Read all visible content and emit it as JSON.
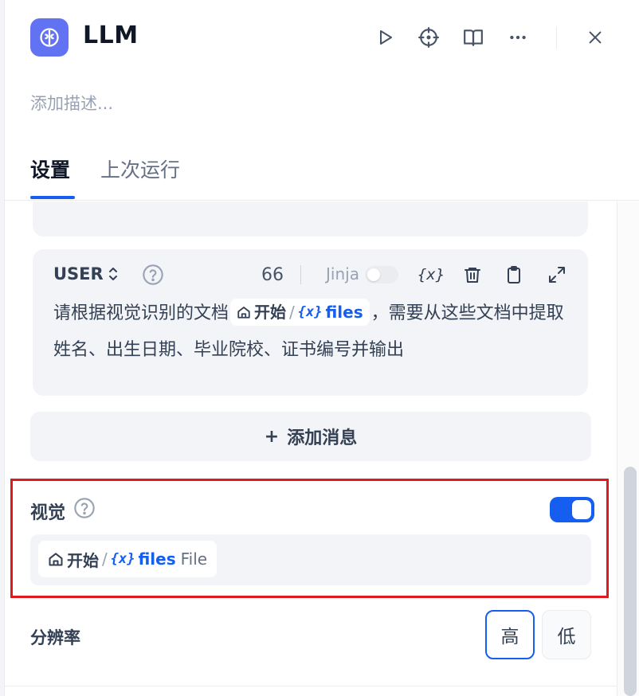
{
  "header": {
    "title": "LLM",
    "description_placeholder": "添加描述..."
  },
  "tabs": [
    {
      "label": "设置",
      "active": true
    },
    {
      "label": "上次运行",
      "active": false
    }
  ],
  "user_message": {
    "role": "USER",
    "token_count": "66",
    "jinja_label": "Jinja",
    "jinja_enabled": false,
    "prompt_before": "请根据视觉识别的文档",
    "var_node": "开始",
    "var_name": "files",
    "prompt_after": "，需要从这些文档中提取姓名、出生日期、毕业院校、证书编号并输出"
  },
  "add_message": {
    "plus": "+",
    "label": "添加消息"
  },
  "vision": {
    "label": "视觉",
    "enabled": true,
    "var_node": "开始",
    "var_name": "files",
    "var_type": "File",
    "highlight_color": "#e0191f"
  },
  "resolution": {
    "label": "分辨率",
    "options": [
      "高",
      "低"
    ],
    "selected": "高"
  },
  "colors": {
    "accent": "#155eef",
    "app_icon": "#6172f3"
  }
}
